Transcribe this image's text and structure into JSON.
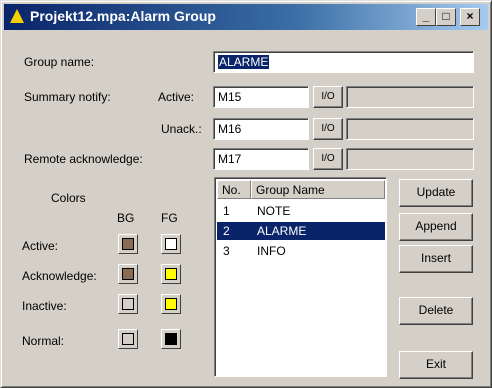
{
  "window": {
    "title": "Projekt12.mpa:Alarm Group",
    "minimize": "_",
    "maximize": "□",
    "close": "×"
  },
  "form": {
    "group_name_label": "Group name:",
    "group_name_value": "ALARME",
    "summary_notify_label": "Summary notify:",
    "active_label": "Active:",
    "active_value": "M15",
    "unack_label": "Unack.:",
    "unack_value": "M16",
    "remote_ack_label": "Remote acknowledge:",
    "remote_ack_value": "M17",
    "io_label": "I/O"
  },
  "colors": {
    "title": "Colors",
    "bg_header": "BG",
    "fg_header": "FG",
    "rows": [
      {
        "label": "Active:",
        "bg": "#8b6a52",
        "fg": "#ffffff"
      },
      {
        "label": "Acknowledge:",
        "bg": "#8b6a52",
        "fg": "#ffff00"
      },
      {
        "label": "Inactive:",
        "bg": "#d4d0c8",
        "fg": "#ffff00"
      },
      {
        "label": "Normal:",
        "bg": "#d4d0c8",
        "fg": "#000000"
      }
    ]
  },
  "groups": {
    "col_no": "No.",
    "col_name": "Group Name",
    "items": [
      {
        "no": "1",
        "name": "NOTE"
      },
      {
        "no": "2",
        "name": "ALARME",
        "selected": true
      },
      {
        "no": "3",
        "name": "INFO"
      }
    ]
  },
  "buttons": {
    "update": "Update",
    "append": "Append",
    "insert": "Insert",
    "delete": "Delete",
    "exit": "Exit"
  }
}
